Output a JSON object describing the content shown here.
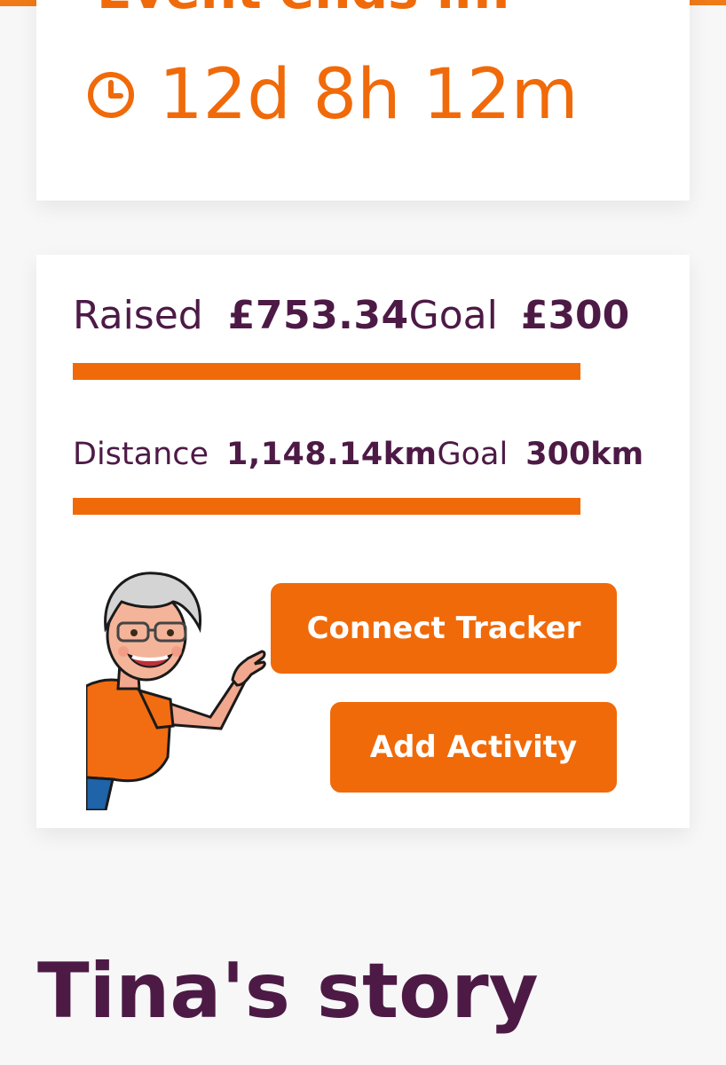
{
  "event": {
    "heading": "Event ends in:",
    "countdown": "12d 8h 12m"
  },
  "fundraising": {
    "raised_label": "Raised",
    "raised_value": "£753.34",
    "goal_label": "Goal",
    "goal_value": "£300",
    "progress_fraction": 1.0
  },
  "distance": {
    "label": "Distance",
    "value": "1,148.14km",
    "goal_label": "Goal",
    "goal_value": "300km",
    "progress_fraction": 1.0
  },
  "actions": {
    "connect_tracker": "Connect Tracker",
    "add_activity": "Add Activity"
  },
  "story": {
    "title": "Tina's story"
  },
  "colors": {
    "accent": "#f06a0a",
    "text": "#4d1a46",
    "background": "#f7f7f8",
    "card": "#ffffff"
  },
  "icons": {
    "countdown": "clock-icon",
    "avatar": "waving-avatar"
  }
}
